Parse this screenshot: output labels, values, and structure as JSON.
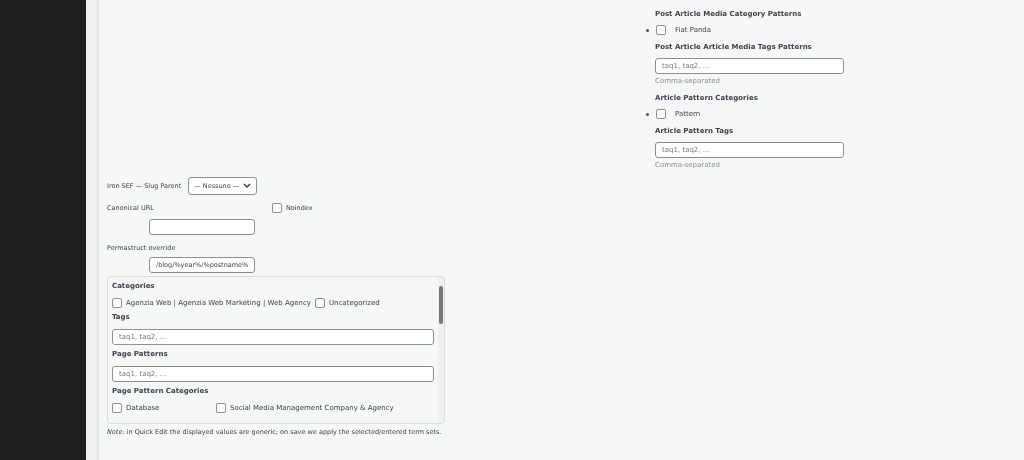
{
  "right_panel": {
    "sections": [
      {
        "kind": "checkboxes",
        "heading": "Post Article Media Category Patterns",
        "options": [
          {
            "label": "Fiat Panda",
            "checked": false
          }
        ]
      },
      {
        "kind": "text",
        "heading": "Post Article Article Media Tags Patterns",
        "placeholder": "taq1, taq2, ...",
        "hint": "Comma-separated"
      },
      {
        "kind": "checkboxes",
        "heading": "Article Pattern Categories",
        "options": [
          {
            "label": "Pattern",
            "checked": false
          }
        ]
      },
      {
        "kind": "text",
        "heading": "Article Pattern Tags",
        "placeholder": "taq1, taq2, ...",
        "hint": "Comma-separated"
      }
    ]
  },
  "seo": {
    "slug_parent_label": "Iron SEF — Slug Parent",
    "slug_parent_value": "— Nessuno —",
    "canonical_label": "Canonical URL",
    "noindex": {
      "label": "Noindex",
      "checked": false
    },
    "permastruct_label": "Permastruct override",
    "permastruct_value": "/blog/%year%/%postname%"
  },
  "terms_box": {
    "sections": [
      {
        "kind": "checkboxes",
        "heading": "Categories",
        "options": [
          {
            "label": "Agenzia Web | Agenzia Web Marketing | Web Agency",
            "checked": false
          },
          {
            "label": "Uncategorized",
            "checked": false
          }
        ]
      },
      {
        "kind": "text",
        "heading": "Tags",
        "placeholder": "taq1, taq2, ..."
      },
      {
        "kind": "text",
        "heading": "Page Patterns",
        "placeholder": "taq1, taq2, ..."
      },
      {
        "kind": "checkboxes",
        "heading": "Page Pattern Categories",
        "options": [
          {
            "label": "Database",
            "checked": false
          },
          {
            "label": "Social Media Management Company & Agency",
            "checked": false
          }
        ]
      }
    ]
  },
  "note": "*Note:* in Quick Edit the displayed values are generic; on save we apply the selected/entered term sets."
}
